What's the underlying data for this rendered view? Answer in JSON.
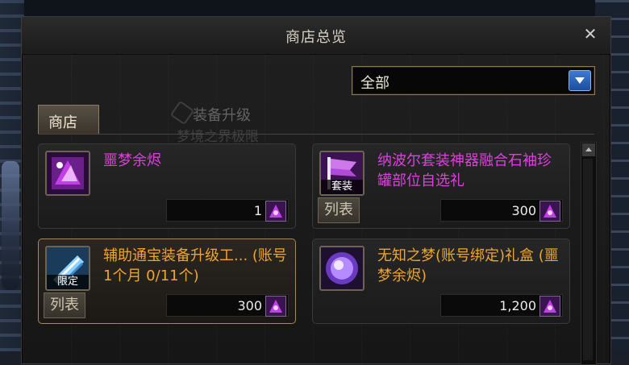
{
  "window": {
    "title": "商店总览",
    "close_symbol": "✕"
  },
  "filter": {
    "selected": "全部"
  },
  "tabs": [
    {
      "label": "商店"
    }
  ],
  "background_overlay": {
    "line1": "装备升级",
    "line2": "梦境之界极限"
  },
  "items": [
    {
      "name": "噩梦余烬",
      "price": "1",
      "name_color": "#e13ee0",
      "icon": "nightmare-ember-icon",
      "badge": "",
      "list_label": ""
    },
    {
      "name": "纳波尔套装神器融合石袖珍罐部位自选礼",
      "price": "300",
      "name_color": "#e13ee0",
      "icon": "purple-flag-icon",
      "badge": "套装",
      "list_label": "列表"
    },
    {
      "name": "辅助通宝装备升级工... (账号1个月 0/11个)",
      "price": "300",
      "name_color": "#f0a52c",
      "icon": "upgrade-tool-icon",
      "badge": "限定",
      "list_label": "列表"
    },
    {
      "name": "无知之梦(账号绑定)礼盒 (噩梦余烬)",
      "price": "1,200",
      "name_color": "#f0a52c",
      "icon": "purple-orb-icon",
      "badge": "",
      "list_label": ""
    }
  ]
}
